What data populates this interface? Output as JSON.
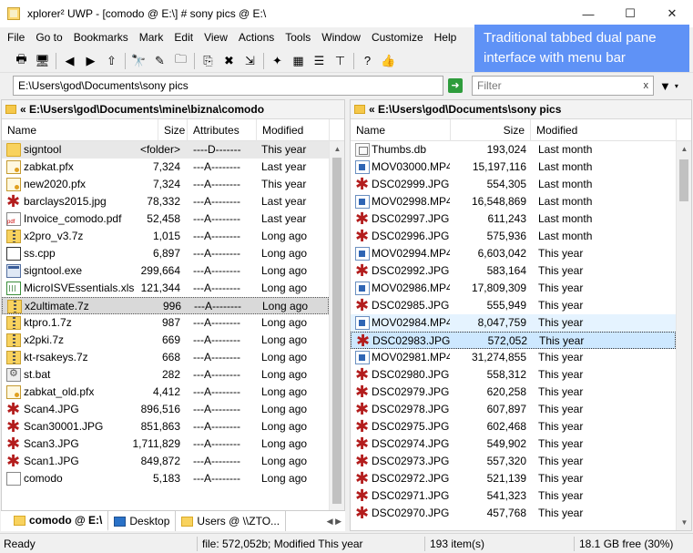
{
  "window": {
    "title": "xplorer² UWP - [comodo @ E:\\] # sony pics @ E:\\",
    "minimize": "—",
    "maximize": "☐",
    "close": "✕"
  },
  "caption": "Traditional tabbed dual pane interface with menu bar",
  "menu": [
    "File",
    "Go to",
    "Bookmarks",
    "Mark",
    "Edit",
    "View",
    "Actions",
    "Tools",
    "Window",
    "Customize",
    "Help"
  ],
  "toolbar": {
    "buttons": [
      {
        "name": "print-icon",
        "glyph": "🖶"
      },
      {
        "name": "computer-icon",
        "glyph": "🖥"
      },
      {
        "name": "back-icon",
        "glyph": "◀"
      },
      {
        "name": "forward-icon",
        "glyph": "▶"
      },
      {
        "name": "up-icon",
        "glyph": "⇧"
      },
      {
        "name": "find-icon",
        "glyph": "🔭"
      },
      {
        "name": "edit-icon",
        "glyph": "✎"
      },
      {
        "name": "new-folder-icon",
        "glyph": "🗀"
      },
      {
        "name": "copy-to-icon",
        "glyph": "⎘"
      },
      {
        "name": "delete-icon",
        "glyph": "✖"
      },
      {
        "name": "move-to-icon",
        "glyph": "⇲"
      },
      {
        "name": "magic-wand-icon",
        "glyph": "✦"
      },
      {
        "name": "properties-icon",
        "glyph": "▦"
      },
      {
        "name": "details-view-icon",
        "glyph": "☰"
      },
      {
        "name": "tree-icon",
        "glyph": "⊤"
      },
      {
        "name": "help-icon",
        "glyph": "?"
      },
      {
        "name": "thumbs-up-icon",
        "glyph": "👍"
      }
    ]
  },
  "address": {
    "value": "E:\\Users\\god\\Documents\\sony pics",
    "filter_placeholder": "Filter",
    "filter_clear": "x"
  },
  "left": {
    "path": "« E:\\Users\\god\\Documents\\mine\\bizna\\comodo",
    "headers": {
      "name": "Name",
      "size": "Size",
      "attributes": "Attributes",
      "modified": "Modified"
    },
    "rows": [
      {
        "icon": "folder",
        "name": "signtool",
        "size": "<folder>",
        "attr": "----D-------",
        "mod": "This year"
      },
      {
        "icon": "cert",
        "name": "zabkat.pfx",
        "size": "7,324",
        "attr": "---A--------",
        "mod": "Last year"
      },
      {
        "icon": "cert",
        "name": "new2020.pfx",
        "size": "7,324",
        "attr": "---A--------",
        "mod": "This year"
      },
      {
        "icon": "jpg",
        "name": "barclays2015.jpg",
        "size": "78,332",
        "attr": "---A--------",
        "mod": "Last year"
      },
      {
        "icon": "pdf",
        "name": "Invoice_comodo.pdf",
        "size": "52,458",
        "attr": "---A--------",
        "mod": "Last year"
      },
      {
        "icon": "zip",
        "name": "x2pro_v3.7z",
        "size": "1,015",
        "attr": "---A--------",
        "mod": "Long ago"
      },
      {
        "icon": "cpp",
        "name": "ss.cpp",
        "size": "6,897",
        "attr": "---A--------",
        "mod": "Long ago"
      },
      {
        "icon": "exe",
        "name": "signtool.exe",
        "size": "299,664",
        "attr": "---A--------",
        "mod": "Long ago"
      },
      {
        "icon": "xls",
        "name": "MicroISVEssentials.xls",
        "size": "121,344",
        "attr": "---A--------",
        "mod": "Long ago"
      },
      {
        "icon": "zip",
        "name": "x2ultimate.7z",
        "size": "996",
        "attr": "---A--------",
        "mod": "Long ago"
      },
      {
        "icon": "zip",
        "name": "ktpro.1.7z",
        "size": "987",
        "attr": "---A--------",
        "mod": "Long ago"
      },
      {
        "icon": "zip",
        "name": "x2pki.7z",
        "size": "669",
        "attr": "---A--------",
        "mod": "Long ago"
      },
      {
        "icon": "zip",
        "name": "kt-rsakeys.7z",
        "size": "668",
        "attr": "---A--------",
        "mod": "Long ago"
      },
      {
        "icon": "bat",
        "name": "st.bat",
        "size": "282",
        "attr": "---A--------",
        "mod": "Long ago"
      },
      {
        "icon": "cert",
        "name": "zabkat_old.pfx",
        "size": "4,412",
        "attr": "---A--------",
        "mod": "Long ago"
      },
      {
        "icon": "jpg",
        "name": "Scan4.JPG",
        "size": "896,516",
        "attr": "---A--------",
        "mod": "Long ago"
      },
      {
        "icon": "jpg",
        "name": "Scan30001.JPG",
        "size": "851,863",
        "attr": "---A--------",
        "mod": "Long ago"
      },
      {
        "icon": "jpg",
        "name": "Scan3.JPG",
        "size": "1,711,829",
        "attr": "---A--------",
        "mod": "Long ago"
      },
      {
        "icon": "jpg",
        "name": "Scan1.JPG",
        "size": "849,872",
        "attr": "---A--------",
        "mod": "Long ago"
      },
      {
        "icon": "file",
        "name": "comodo",
        "size": "5,183",
        "attr": "---A--------",
        "mod": "Long ago"
      }
    ]
  },
  "right": {
    "path": "« E:\\Users\\god\\Documents\\sony pics",
    "headers": {
      "name": "Name",
      "size": "Size",
      "modified": "Modified"
    },
    "rows": [
      {
        "icon": "db",
        "name": "Thumbs.db",
        "size": "193,024",
        "mod": "Last month"
      },
      {
        "icon": "mp4",
        "name": "MOV03000.MP4",
        "size": "15,197,116",
        "mod": "Last month"
      },
      {
        "icon": "jpg",
        "name": "DSC02999.JPG",
        "size": "554,305",
        "mod": "Last month"
      },
      {
        "icon": "mp4",
        "name": "MOV02998.MP4",
        "size": "16,548,869",
        "mod": "Last month"
      },
      {
        "icon": "jpg",
        "name": "DSC02997.JPG",
        "size": "611,243",
        "mod": "Last month"
      },
      {
        "icon": "jpg",
        "name": "DSC02996.JPG",
        "size": "575,936",
        "mod": "Last month"
      },
      {
        "icon": "mp4",
        "name": "MOV02994.MP4",
        "size": "6,603,042",
        "mod": "This year"
      },
      {
        "icon": "jpg",
        "name": "DSC02992.JPG",
        "size": "583,164",
        "mod": "This year"
      },
      {
        "icon": "mp4",
        "name": "MOV02986.MP4",
        "size": "17,809,309",
        "mod": "This year"
      },
      {
        "icon": "jpg",
        "name": "DSC02985.JPG",
        "size": "555,949",
        "mod": "This year"
      },
      {
        "icon": "mp4",
        "name": "MOV02984.MP4",
        "size": "8,047,759",
        "mod": "This year"
      },
      {
        "icon": "jpg",
        "name": "DSC02983.JPG",
        "size": "572,052",
        "mod": "This year"
      },
      {
        "icon": "mp4",
        "name": "MOV02981.MP4",
        "size": "31,274,855",
        "mod": "This year"
      },
      {
        "icon": "jpg",
        "name": "DSC02980.JPG",
        "size": "558,312",
        "mod": "This year"
      },
      {
        "icon": "jpg",
        "name": "DSC02979.JPG",
        "size": "620,258",
        "mod": "This year"
      },
      {
        "icon": "jpg",
        "name": "DSC02978.JPG",
        "size": "607,897",
        "mod": "This year"
      },
      {
        "icon": "jpg",
        "name": "DSC02975.JPG",
        "size": "602,468",
        "mod": "This year"
      },
      {
        "icon": "jpg",
        "name": "DSC02974.JPG",
        "size": "549,902",
        "mod": "This year"
      },
      {
        "icon": "jpg",
        "name": "DSC02973.JPG",
        "size": "557,320",
        "mod": "This year"
      },
      {
        "icon": "jpg",
        "name": "DSC02972.JPG",
        "size": "521,139",
        "mod": "This year"
      },
      {
        "icon": "jpg",
        "name": "DSC02971.JPG",
        "size": "541,323",
        "mod": "This year"
      },
      {
        "icon": "jpg",
        "name": "DSC02970.JPG",
        "size": "457,768",
        "mod": "This year"
      }
    ]
  },
  "tabs": [
    {
      "label": "comodo @ E:\\",
      "icon": "folder",
      "active": true
    },
    {
      "label": "Desktop",
      "icon": "desktop",
      "active": false
    },
    {
      "label": "Users @ \\\\ZTO...",
      "icon": "folder",
      "active": false
    }
  ],
  "status": {
    "ready": "Ready",
    "file_info": "file: 572,052b; Modified This year",
    "items": "193 item(s)",
    "free": "18.1 GB free (30%)"
  }
}
